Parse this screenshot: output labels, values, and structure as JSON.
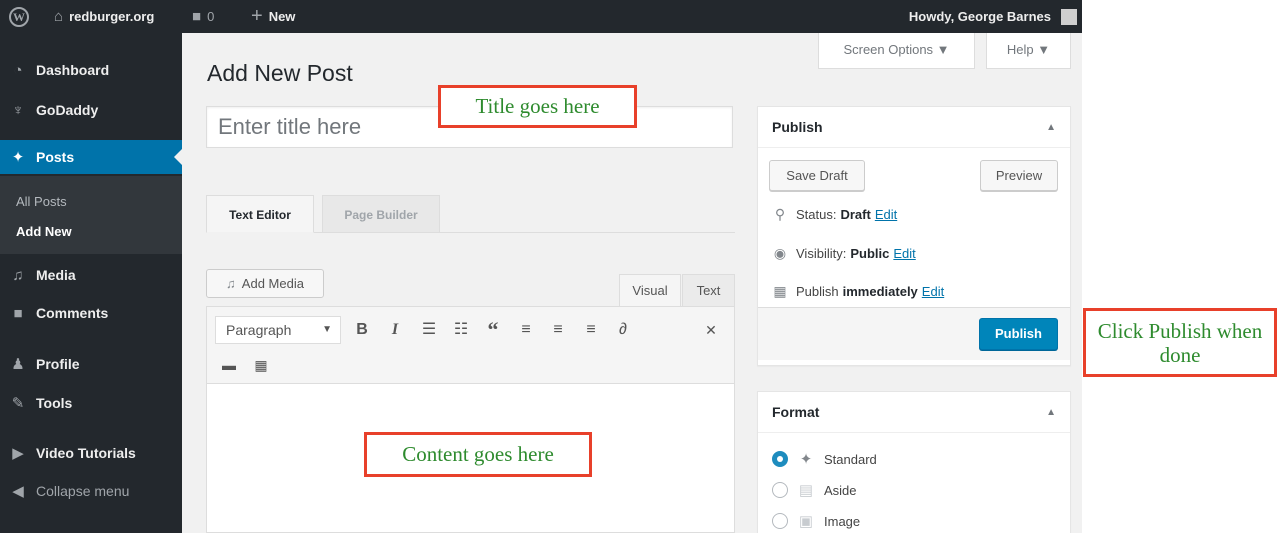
{
  "adminbar": {
    "site_name": "redburger.org",
    "comments_count": "0",
    "new_label": "New",
    "howdy": "Howdy, George Barnes"
  },
  "screen_meta": {
    "screen_options": "Screen Options ▼",
    "help": "Help ▼"
  },
  "sidebar": {
    "items": [
      {
        "label": "Dashboard",
        "icon": "dashboard-icon"
      },
      {
        "label": "GoDaddy",
        "icon": "godaddy-icon"
      },
      {
        "label": "Posts",
        "icon": "pin-icon"
      },
      {
        "label": "Media",
        "icon": "media-icon"
      },
      {
        "label": "Comments",
        "icon": "comment-icon"
      },
      {
        "label": "Profile",
        "icon": "user-icon"
      },
      {
        "label": "Tools",
        "icon": "wrench-icon"
      },
      {
        "label": "Video Tutorials",
        "icon": "video-icon"
      },
      {
        "label": "Collapse menu",
        "icon": "collapse-icon"
      }
    ],
    "submenu": [
      "All Posts",
      "Add New"
    ],
    "active": "Posts"
  },
  "main": {
    "page_title": "Add New Post",
    "title_placeholder": "Enter title here",
    "editor_tabs": [
      "Text Editor",
      "Page Builder"
    ],
    "add_media": "Add Media",
    "mode_tabs": [
      "Visual",
      "Text"
    ],
    "format_select": "Paragraph"
  },
  "publish_box": {
    "title": "Publish",
    "save_draft": "Save Draft",
    "preview": "Preview",
    "status_label": "Status:",
    "status_value": "Draft",
    "visibility_label": "Visibility:",
    "visibility_value": "Public",
    "publish_label": "Publish",
    "publish_value": "immediately",
    "edit": "Edit",
    "publish_button": "Publish"
  },
  "format_box": {
    "title": "Format",
    "options": [
      "Standard",
      "Aside",
      "Image"
    ],
    "selected": "Standard"
  },
  "annotations": {
    "title": "Title goes here",
    "content": "Content goes here",
    "publish": "Click Publish when done"
  },
  "colors": {
    "admin_dark": "#23282d",
    "accent_blue": "#0073aa",
    "primary_button": "#0085ba",
    "callout_border": "#e8402a",
    "callout_text": "#2e8b2e"
  }
}
